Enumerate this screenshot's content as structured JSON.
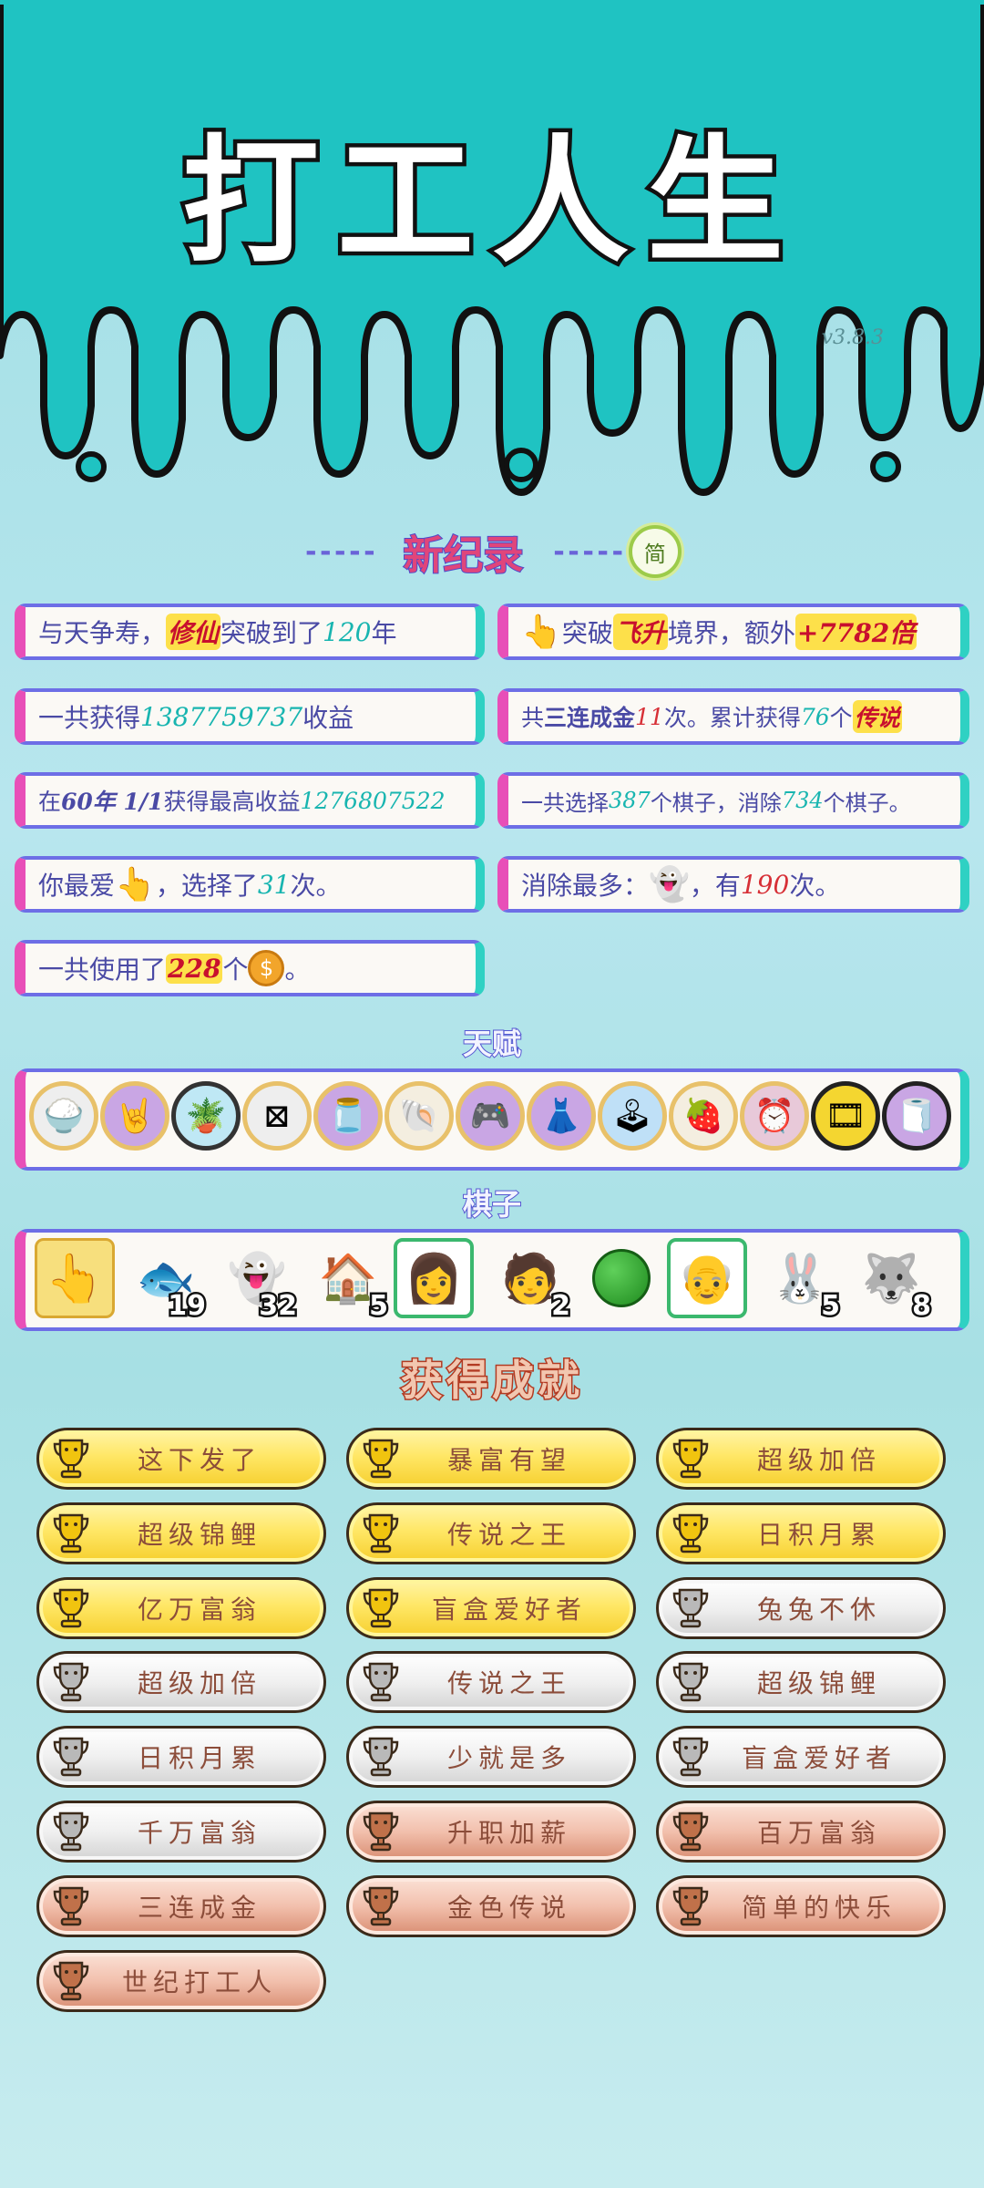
{
  "header": {
    "title": "打工人生",
    "version": "v3.8.3",
    "colors": {
      "teal": "#1fc3c2",
      "drip_outline": "#111111"
    }
  },
  "record": {
    "dashes_left": "-----",
    "title": "新纪录",
    "dashes_right": "-----",
    "simple_button": "简"
  },
  "stats": {
    "s1": {
      "a": "与天争寿，",
      "b": "修仙",
      "c": "突破到了",
      "d": "120",
      "e": "年"
    },
    "s2": {
      "icon": "pointing-hand-icon",
      "a": "突破",
      "b": "飞升",
      "c": "境界，额外",
      "d": "+7782倍"
    },
    "s3": {
      "a": "一共获得",
      "b": "1387759737",
      "c": "收益"
    },
    "s4": {
      "a": "共",
      "b": "三连成金",
      "c": "11",
      "d": "次。累计获得",
      "e": "76",
      "f": "个",
      "g": "传说"
    },
    "s5": {
      "a": "在 ",
      "b": "60年 1/1",
      "c": " 获得最高收益",
      "d": "1276807522"
    },
    "s6": {
      "a": "一共选择",
      "b": "387",
      "c": "个棋子，消除",
      "d": "734",
      "e": "个棋子。"
    },
    "s7": {
      "a": "你最爱",
      "icon": "pointing-hand-icon",
      "b": "，选择了",
      "c": "31",
      "d": "次。"
    },
    "s8": {
      "a": "消除最多：",
      "icon": "ghost-icon",
      "b": "，有",
      "c": "190",
      "d": "次。"
    },
    "s9": {
      "a": "一共使用了",
      "b": "228",
      "c": "个",
      "icon": "coin-icon",
      "d": "。"
    }
  },
  "talents": {
    "title": "天赋",
    "items": [
      "rice-bowl-icon",
      "rock-hand-icon",
      "flower-pot-icon",
      "ad-block-icon",
      "jar-icon",
      "shell-icon",
      "gamer-icon",
      "skirt-icon",
      "arcade-icon",
      "fruit-bowl-icon",
      "time-clock-icon",
      "film-icon",
      "tissue-box-icon"
    ]
  },
  "pieces": {
    "title": "棋子",
    "items": [
      {
        "icon": "pointing-hand-icon",
        "count": ""
      },
      {
        "icon": "koi-fish-icon",
        "count": "19"
      },
      {
        "icon": "ghost-icon",
        "count": "32"
      },
      {
        "icon": "house-icon",
        "count": "5"
      },
      {
        "icon": "girl-avatar-icon",
        "count": ""
      },
      {
        "icon": "green-hat-man-icon",
        "count": "2"
      },
      {
        "icon": "watermelon-icon",
        "count": ""
      },
      {
        "icon": "bald-man-icon",
        "count": ""
      },
      {
        "icon": "rabbit-house-icon",
        "count": "5"
      },
      {
        "icon": "husky-king-icon",
        "count": "8"
      }
    ]
  },
  "achievements": {
    "title": "获得成就",
    "items": [
      {
        "label": "这下发了",
        "tier": "gold"
      },
      {
        "label": "暴富有望",
        "tier": "gold"
      },
      {
        "label": "超级加倍",
        "tier": "gold"
      },
      {
        "label": "超级锦鲤",
        "tier": "gold"
      },
      {
        "label": "传说之王",
        "tier": "gold"
      },
      {
        "label": "日积月累",
        "tier": "gold"
      },
      {
        "label": "亿万富翁",
        "tier": "gold"
      },
      {
        "label": "盲盒爱好者",
        "tier": "gold"
      },
      {
        "label": "兔兔不休",
        "tier": "silver"
      },
      {
        "label": "超级加倍",
        "tier": "silver"
      },
      {
        "label": "传说之王",
        "tier": "silver"
      },
      {
        "label": "超级锦鲤",
        "tier": "silver"
      },
      {
        "label": "日积月累",
        "tier": "silver"
      },
      {
        "label": "少就是多",
        "tier": "silver"
      },
      {
        "label": "盲盒爱好者",
        "tier": "silver"
      },
      {
        "label": "千万富翁",
        "tier": "silver"
      },
      {
        "label": "升职加薪",
        "tier": "bronze"
      },
      {
        "label": "百万富翁",
        "tier": "bronze"
      },
      {
        "label": "三连成金",
        "tier": "bronze"
      },
      {
        "label": "金色传说",
        "tier": "bronze"
      },
      {
        "label": "简单的快乐",
        "tier": "bronze"
      },
      {
        "label": "世纪打工人",
        "tier": "bronze"
      }
    ]
  }
}
